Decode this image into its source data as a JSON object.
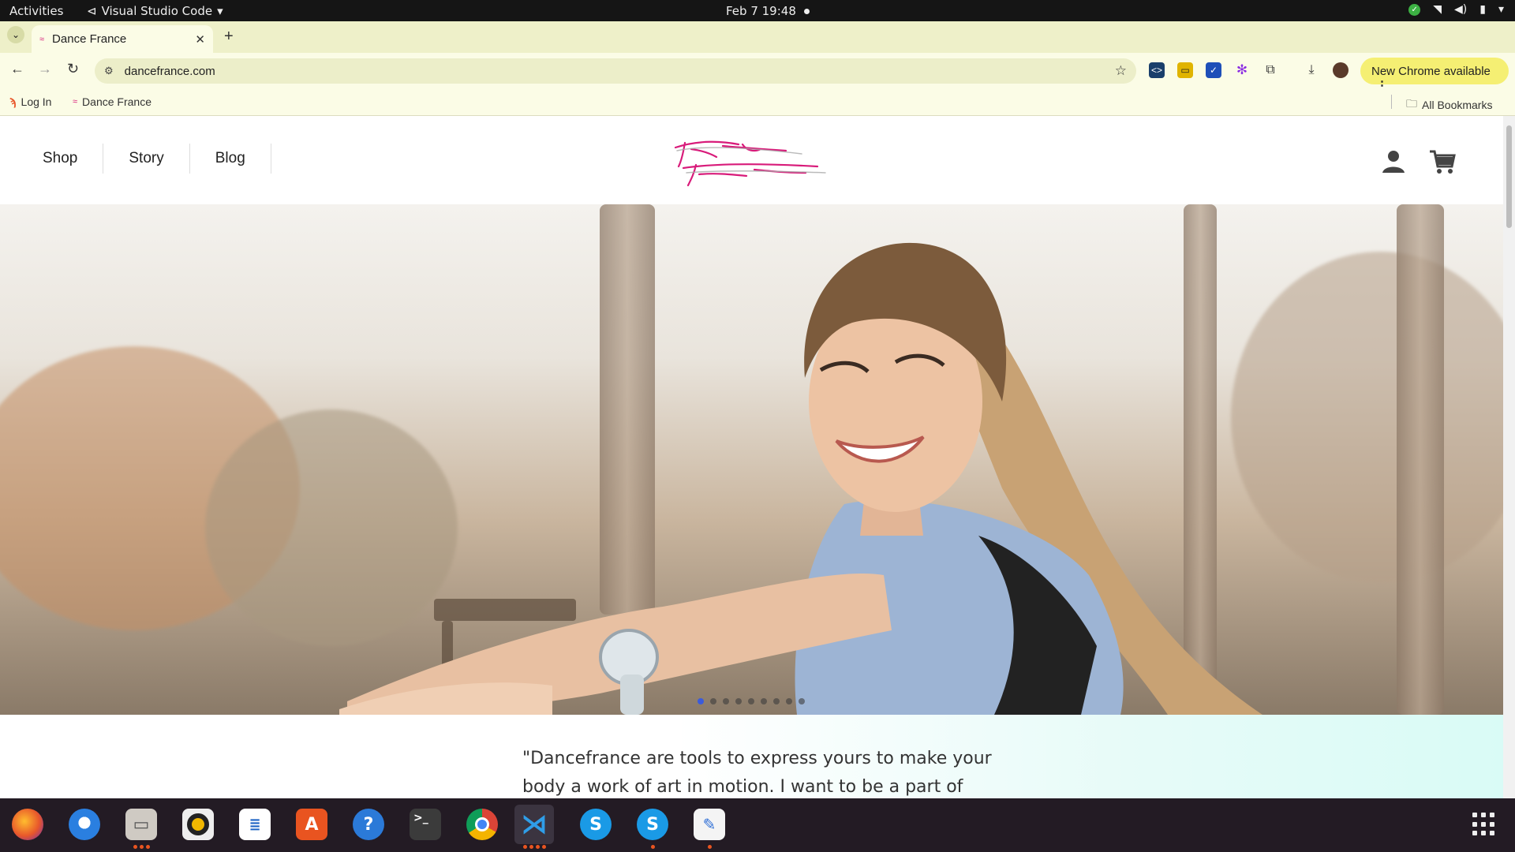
{
  "topbar": {
    "activities": "Activities",
    "app_name": "Visual Studio Code",
    "datetime": "Feb 7  19:48"
  },
  "browser": {
    "tab_title": "Dance France",
    "url": "dancefrance.com",
    "new_chrome": "New Chrome available",
    "bookmarks": {
      "login": "Log In",
      "dance_france": "Dance France",
      "all_bookmarks": "All Bookmarks"
    }
  },
  "site": {
    "nav": [
      "Shop",
      "Story",
      "Blog"
    ],
    "logo_text": "Dance France",
    "carousel": {
      "slides": 9,
      "active": 1
    },
    "quote": "\"Dancefrance are tools to express yours to make your body a work of art in motion. I want to be a part of that"
  },
  "colors": {
    "accent_pink": "#d81b7a",
    "carousel_active": "#3b5bdb",
    "new_chrome_bg": "#f5ef73"
  },
  "dock": {
    "apps": [
      "firefox-icon",
      "thunderbird-icon",
      "files-icon",
      "rhythmbox-icon",
      "writer-icon",
      "app-center-icon",
      "help-icon",
      "terminal-icon",
      "chrome-icon",
      "vscode-icon",
      "skype-icon",
      "skype-icon",
      "text-editor-icon"
    ]
  }
}
